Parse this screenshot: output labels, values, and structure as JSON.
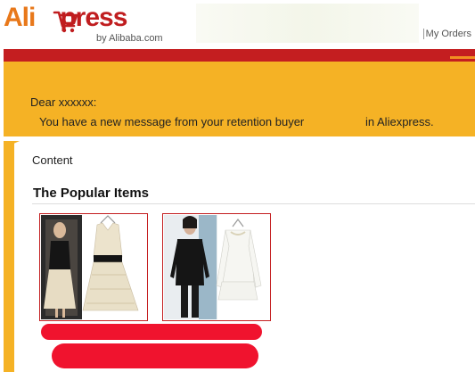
{
  "header": {
    "logo": {
      "part1": "Ali",
      "part2": "press",
      "tagline": "by Alibaba.com"
    },
    "my_orders_label": "My Orders"
  },
  "banner": {
    "greeting": "Dear xxxxxx:",
    "message": "You have a new message from your retention buyer",
    "message_tail": "in Aliexpress."
  },
  "content": {
    "label": "Content",
    "section_title": "The Popular Items"
  },
  "colors": {
    "brand_red": "#c41e20",
    "brand_orange": "#f5b225",
    "redaction_red": "#f0132e"
  },
  "icons": [
    "shopping-cart-icon"
  ]
}
